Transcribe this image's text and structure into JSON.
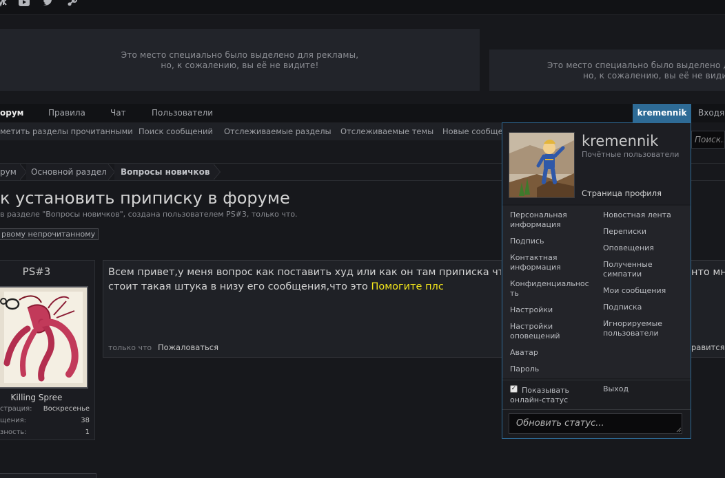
{
  "social": [
    "vk-icon",
    "youtube-icon",
    "twitter-icon",
    "steam-icon"
  ],
  "ads": {
    "banner1": [
      "Это место специально было выделено для рекламы,",
      "но, к сожалению, вы её не видите!"
    ],
    "banner2": [
      "Это место специально было выделено для",
      "но, к сожалению, вы её не видите!"
    ]
  },
  "nav": {
    "items": [
      "орум",
      "Правила",
      "Чат",
      "Пользователи"
    ],
    "user": "kremennik",
    "inbox": "Входящ"
  },
  "subnav": [
    "метить разделы прочитанными",
    "Поиск сообщений",
    "Отслеживаемые разделы",
    "Отслеживаемые темы",
    "Новые сообще"
  ],
  "search_placeholder": "Поиск...",
  "breadcrumb": [
    "рум",
    "Основной раздел",
    "Вопросы новичков"
  ],
  "thread": {
    "title": "к установить приписку в форуме",
    "meta": "в разделе \"Вопросы новичков\", создана пользователем PS#3, только что.",
    "first_unread": "рвому непрочитанному"
  },
  "author": {
    "name": "PS#3",
    "title": "Killing Spree",
    "stats": [
      {
        "label": "страция:",
        "value": "Воскресенье"
      },
      {
        "label": "щения:",
        "value": "38"
      },
      {
        "label": "зность:",
        "value": "1"
      }
    ]
  },
  "post": {
    "line1": "Всем привет,у меня вопрос как поставить худ или как он там приписка что",
    "line2": "стоит такая штука в низу его сообщения,что это ",
    "highlight": "Помогите плс",
    "line1_right": "нто мно",
    "time": "только что",
    "report": "Пожаловаться",
    "like": "равится"
  },
  "dropdown": {
    "name": "kremennik",
    "role": "Почётные пользователи",
    "profile_link": "Страница профиля",
    "left_menu": [
      [
        "Персональная",
        "информация"
      ],
      [
        "Подпись"
      ],
      [
        "Контактная",
        "информация"
      ],
      [
        "Конфиденциальнос",
        "ть"
      ],
      [
        "Настройки"
      ],
      [
        "Настройки",
        "оповещений"
      ],
      [
        "Аватар"
      ],
      [
        "Пароль"
      ]
    ],
    "right_menu": [
      [
        "Новостная лента"
      ],
      [
        "Переписки"
      ],
      [
        "Оповещения"
      ],
      [
        "Полученные",
        "симпатии"
      ],
      [
        "Мои сообщения"
      ],
      [
        "Подписка"
      ],
      [
        "Игнорируемые",
        "пользователи"
      ]
    ],
    "show_online": [
      "Показывать",
      "онлайн-статус"
    ],
    "show_online_checked": true,
    "logout": "Выход",
    "status_placeholder": "Обновить статус..."
  },
  "colors": {
    "accent": "#2e6b96",
    "highlight": "#f2e51b"
  }
}
